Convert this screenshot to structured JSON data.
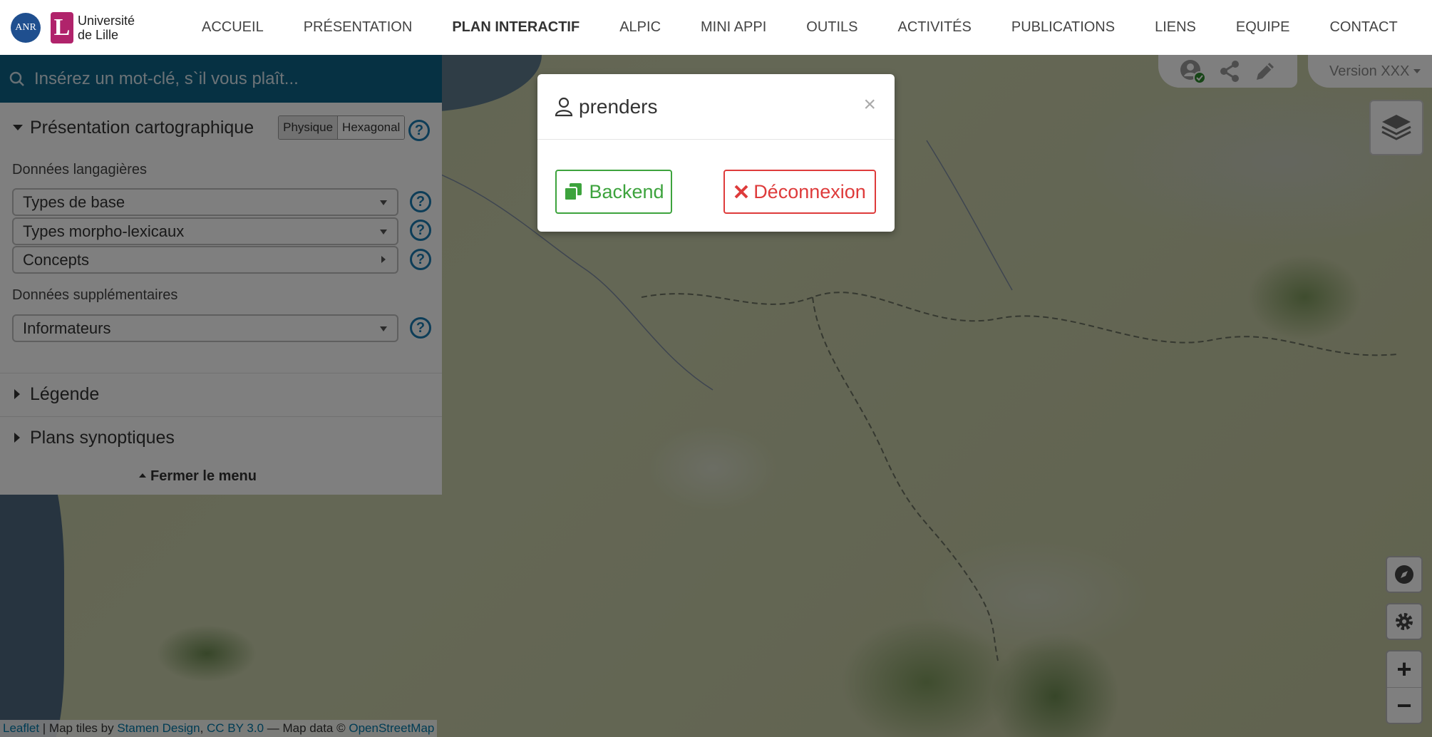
{
  "header": {
    "anr_logo_text": "ANR",
    "university_name_line1": "Université",
    "university_name_line2": "de Lille",
    "nav": [
      {
        "label": "ACCUEIL"
      },
      {
        "label": "PRÉSENTATION"
      },
      {
        "label": "PLAN INTERACTIF",
        "active": true
      },
      {
        "label": "ALPIC"
      },
      {
        "label": "MINI APPI"
      },
      {
        "label": "OUTILS"
      },
      {
        "label": "ACTIVITÉS"
      },
      {
        "label": "PUBLICATIONS"
      },
      {
        "label": "LIENS"
      },
      {
        "label": "EQUIPE"
      },
      {
        "label": "CONTACT"
      }
    ]
  },
  "sidebar": {
    "search_placeholder": "Insérez un mot-clé, s`il vous plaît...",
    "presentation_title": "Présentation cartographique",
    "mode_physique": "Physique",
    "mode_hexagonal": "Hexagonal",
    "help_symbol": "?",
    "language_data_label": "Données langagières",
    "dropdowns": {
      "types_base": "Types de base",
      "types_morpho": "Types morpho-lexicaux",
      "concepts": "Concepts",
      "informateurs": "Informateurs"
    },
    "extra_data_label": "Données supplémentaires",
    "legend_title": "Légende",
    "synoptic_title": "Plans synoptiques",
    "close_menu": "Fermer le menu"
  },
  "toolbar": {
    "version": "Version XXX"
  },
  "map": {
    "zoom_in": "+",
    "zoom_out": "−"
  },
  "attribution": {
    "leaflet": "Leaflet",
    "tiles_prefix": " | Map tiles by ",
    "stamen": "Stamen Design",
    "comma": ", ",
    "license": "CC BY 3.0",
    "data_prefix": " — Map data © ",
    "osm": "OpenStreetMap"
  },
  "modal": {
    "username": "prenders",
    "close_symbol": "×",
    "backend_label": "Backend",
    "logout_label": "Déconnexion"
  },
  "colors": {
    "brand_blue": "#0d6286",
    "help_blue": "#1a7bb0",
    "lille_magenta": "#b0236b",
    "success_green": "#3da33d",
    "danger_red": "#de3b3b"
  }
}
